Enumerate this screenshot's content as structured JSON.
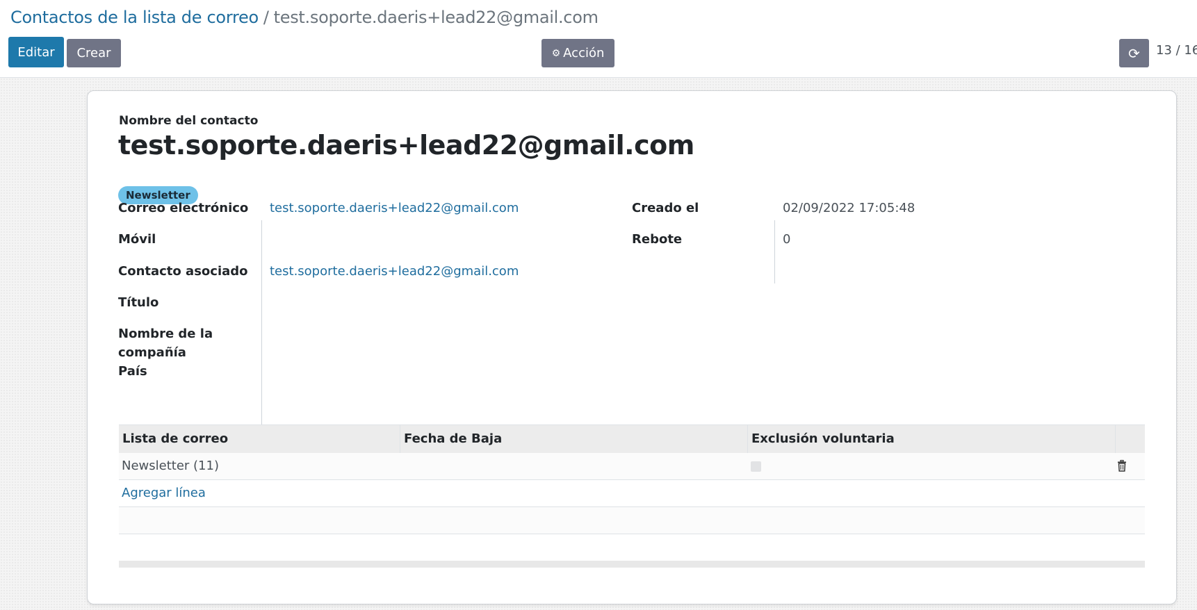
{
  "breadcrumb": {
    "parent": "Contactos de la lista de correo",
    "separator": "/",
    "current": "test.soporte.daeris+lead22@gmail.com"
  },
  "toolbar": {
    "edit_label": "Editar",
    "create_label": "Crear",
    "action_label": "Acción",
    "action_icon": "gear-icon",
    "refresh_icon": "refresh-icon"
  },
  "pager": {
    "value": "13 / 16"
  },
  "form": {
    "name_label": "Nombre del contacto",
    "name_value": "test.soporte.daeris+lead22@gmail.com",
    "tag": "Newsletter",
    "left_fields": {
      "email_label": "Correo electrónico",
      "email_value": "test.soporte.daeris+lead22@gmail.com",
      "mobile_label": "Móvil",
      "mobile_value": "",
      "partner_label": "Contacto asociado",
      "partner_value": "test.soporte.daeris+lead22@gmail.com",
      "title_label": "Título",
      "title_value": "",
      "company_label_1": "Nombre de la",
      "company_label_2": "compañía",
      "company_value": "",
      "country_label": "País",
      "country_value": ""
    },
    "right_fields": {
      "created_label": "Creado el",
      "created_value": "02/09/2022 17:05:48",
      "bounce_label": "Rebote",
      "bounce_value": "0"
    }
  },
  "subscriptions": {
    "columns": [
      "Lista de correo",
      "Fecha de Baja",
      "Exclusión voluntaria"
    ],
    "rows": [
      {
        "list": "Newsletter (11)",
        "unsubscribe_date": "",
        "opt_out": false
      }
    ],
    "add_line_label": "Agregar línea"
  },
  "colors": {
    "primary": "#1e79ab",
    "secondary": "#707486",
    "link": "#1f6d9e",
    "tag": "#6ec1e8"
  }
}
